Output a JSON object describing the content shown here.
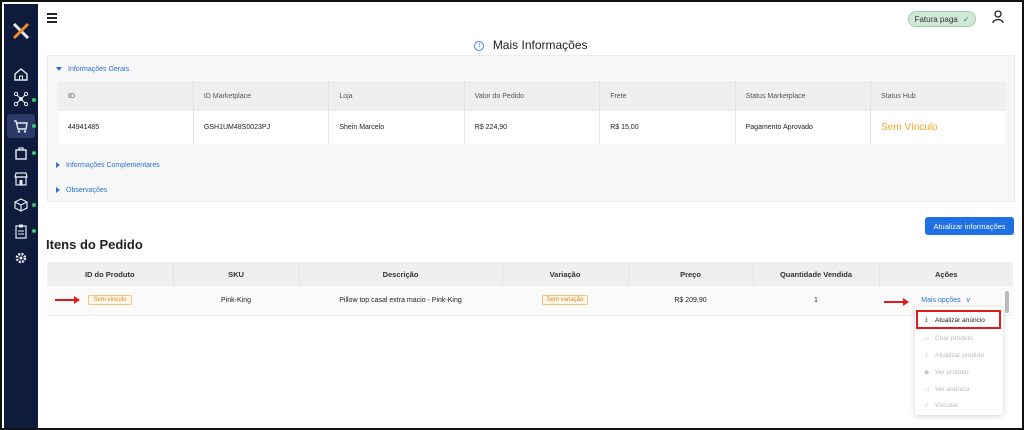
{
  "app": {
    "logo_icon": "x-logo-icon",
    "accent_color": "#1f6fe5",
    "warning_color": "#f5a623"
  },
  "sidebar": {
    "items": [
      {
        "name": "home",
        "icon": "home-icon"
      },
      {
        "name": "integrations",
        "icon": "hub-icon"
      },
      {
        "name": "orders",
        "icon": "cart-icon",
        "active": true
      },
      {
        "name": "products",
        "icon": "bag-icon"
      },
      {
        "name": "store",
        "icon": "store-icon"
      },
      {
        "name": "inventory",
        "icon": "box-icon"
      },
      {
        "name": "reports",
        "icon": "clipboard-icon"
      },
      {
        "name": "settings",
        "icon": "gear-icon"
      }
    ]
  },
  "header": {
    "fatura_label": "Fatura paga",
    "page_title": "Mais Informações"
  },
  "sections": {
    "gerais": "Informações Gerais",
    "complementares": "Informações Complementares",
    "observacoes": "Observações"
  },
  "info_table": {
    "headers": [
      "ID",
      "ID Marketplace",
      "Loja",
      "Valor do Pedido",
      "Frete",
      "Status Marketplace",
      "Status Hub"
    ],
    "row": [
      "44941485",
      "GSH1UM48S0023PJ",
      "Shein Marcelo",
      "R$ 224,90",
      "R$ 15,00",
      "Pagamento Aprovado",
      "Sem Vínculo"
    ]
  },
  "update_button": "Atualizar informações",
  "items_section": {
    "title": "Itens do Pedido",
    "headers": [
      "ID do Produto",
      "SKU",
      "Descrição",
      "Variação",
      "Preço",
      "Quantidade Vendida",
      "Ações"
    ],
    "row": {
      "product_id_tag": "Sem vínculo",
      "sku": "Pink-King",
      "description": "Pillow top casal extra macio - Pink-King",
      "variation_tag": "Sem variação",
      "price": "R$ 209,90",
      "quantity": "1",
      "actions": "Mais opções"
    }
  },
  "dropdown": {
    "items": [
      {
        "label": "Atualizar anúncio",
        "icon": "download-icon",
        "enabled": true
      },
      {
        "label": "Criar produto",
        "icon": "file-icon",
        "enabled": false
      },
      {
        "label": "Atualizar produto",
        "icon": "download-icon",
        "enabled": false
      },
      {
        "label": "Ver produto",
        "icon": "eye-icon",
        "enabled": false
      },
      {
        "label": "Ver anúncio",
        "icon": "megaphone-icon",
        "enabled": false
      },
      {
        "label": "Vincular",
        "icon": "check-icon",
        "enabled": false
      }
    ]
  }
}
